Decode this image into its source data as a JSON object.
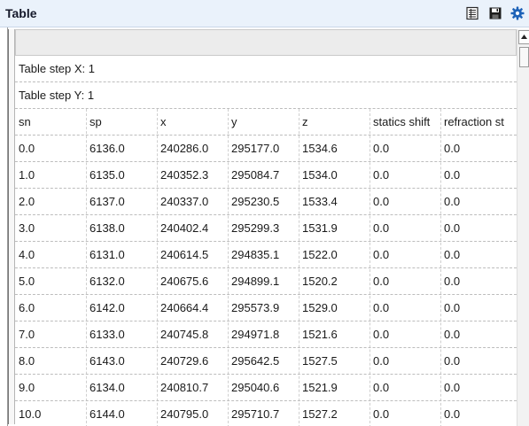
{
  "window": {
    "title": "Table",
    "toolbar_icons": [
      "spreadsheet-icon",
      "save-icon",
      "gear-icon"
    ]
  },
  "table": {
    "step_x_label": "Table step X: 1",
    "step_y_label": "Table step Y: 1",
    "columns": [
      "sn",
      "sp",
      "x",
      "y",
      "z",
      "statics shift",
      "refraction st"
    ],
    "rows": [
      [
        "0.0",
        "6136.0",
        "240286.0",
        "295177.0",
        "1534.6",
        "0.0",
        "0.0"
      ],
      [
        "1.0",
        "6135.0",
        "240352.3",
        "295084.7",
        "1534.0",
        "0.0",
        "0.0"
      ],
      [
        "2.0",
        "6137.0",
        "240337.0",
        "295230.5",
        "1533.4",
        "0.0",
        "0.0"
      ],
      [
        "3.0",
        "6138.0",
        "240402.4",
        "295299.3",
        "1531.9",
        "0.0",
        "0.0"
      ],
      [
        "4.0",
        "6131.0",
        "240614.5",
        "294835.1",
        "1522.0",
        "0.0",
        "0.0"
      ],
      [
        "5.0",
        "6132.0",
        "240675.6",
        "294899.1",
        "1520.2",
        "0.0",
        "0.0"
      ],
      [
        "6.0",
        "6142.0",
        "240664.4",
        "295573.9",
        "1529.0",
        "0.0",
        "0.0"
      ],
      [
        "7.0",
        "6133.0",
        "240745.8",
        "294971.8",
        "1521.6",
        "0.0",
        "0.0"
      ],
      [
        "8.0",
        "6143.0",
        "240729.6",
        "295642.5",
        "1527.5",
        "0.0",
        "0.0"
      ],
      [
        "9.0",
        "6134.0",
        "240810.7",
        "295040.6",
        "1521.9",
        "0.0",
        "0.0"
      ],
      [
        "10.0",
        "6144.0",
        "240795.0",
        "295710.7",
        "1527.2",
        "0.0",
        "0.0"
      ]
    ]
  },
  "colors": {
    "titlebar_bg": "#eaf2fb",
    "accent_gear": "#1e63b8"
  }
}
